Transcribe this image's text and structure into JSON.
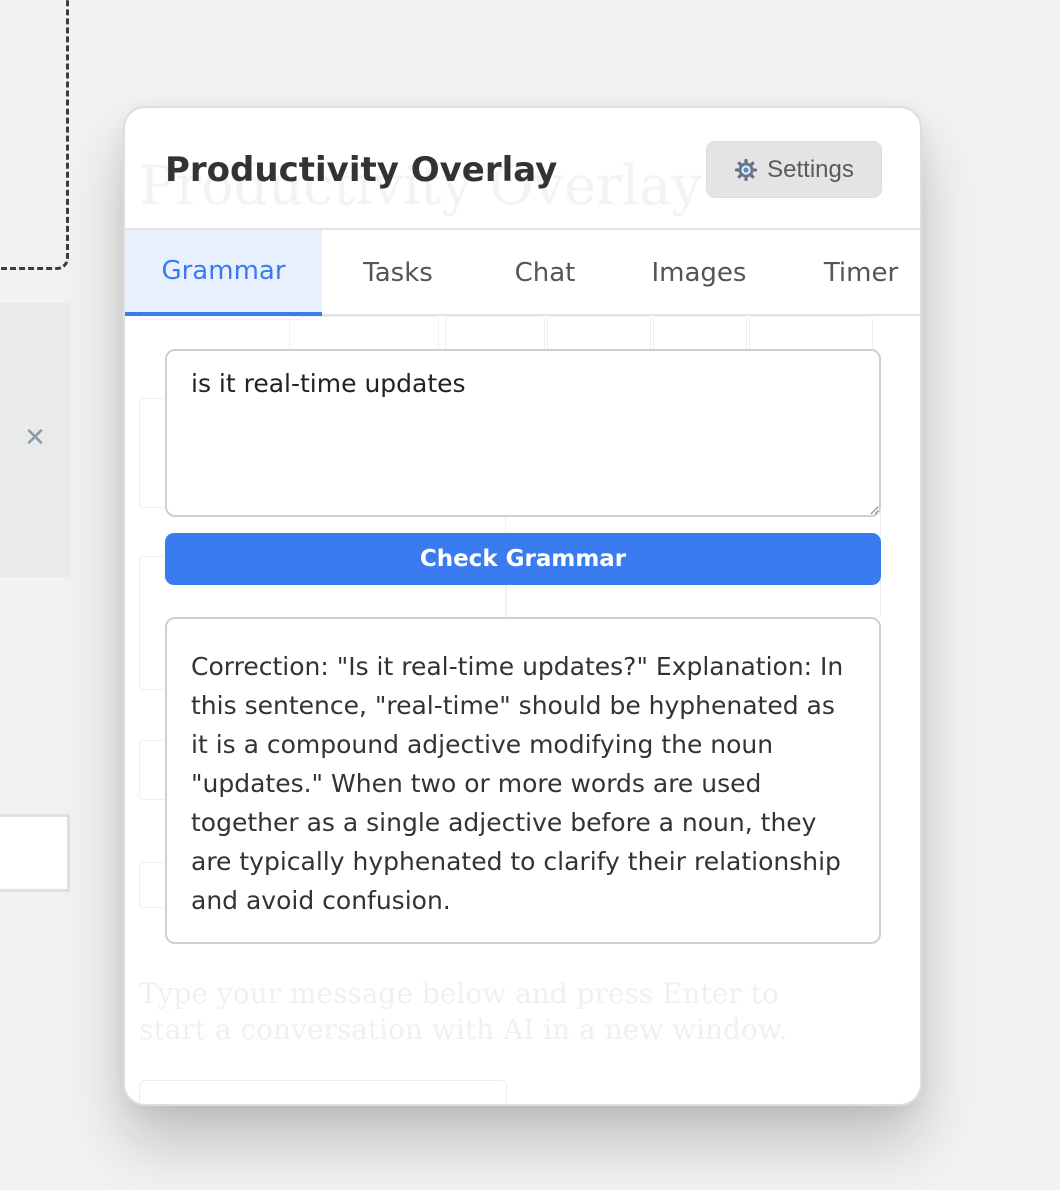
{
  "background": {
    "close_glyph": "✕"
  },
  "ghost": {
    "title": "Productivity Overlay",
    "instructions": "Type your message below and press Enter to start a conversation with AI in a new window."
  },
  "overlay": {
    "title": "Productivity Overlay",
    "settings": {
      "icon": "gear-icon",
      "label": "Settings"
    },
    "tabs": [
      {
        "label": "Grammar",
        "active": true
      },
      {
        "label": "Tasks",
        "active": false
      },
      {
        "label": "Chat",
        "active": false
      },
      {
        "label": "Images",
        "active": false
      },
      {
        "label": "Timer",
        "active": false
      }
    ],
    "grammar": {
      "input_value": "is it real-time updates",
      "check_label": "Check Grammar",
      "result": "Correction: \"Is it real-time updates?\" Explanation: In this sentence, \"real-time\" should be hyphenated as it is a compound adjective modifying the noun \"updates.\" When two or more words are used together as a single adjective before a noun, they are typically hyphenated to clarify their relationship and avoid confusion."
    }
  },
  "colors": {
    "accent": "#3b7bf0",
    "active_tab_bg": "#e8effd",
    "settings_bg": "#e4e4e4"
  }
}
